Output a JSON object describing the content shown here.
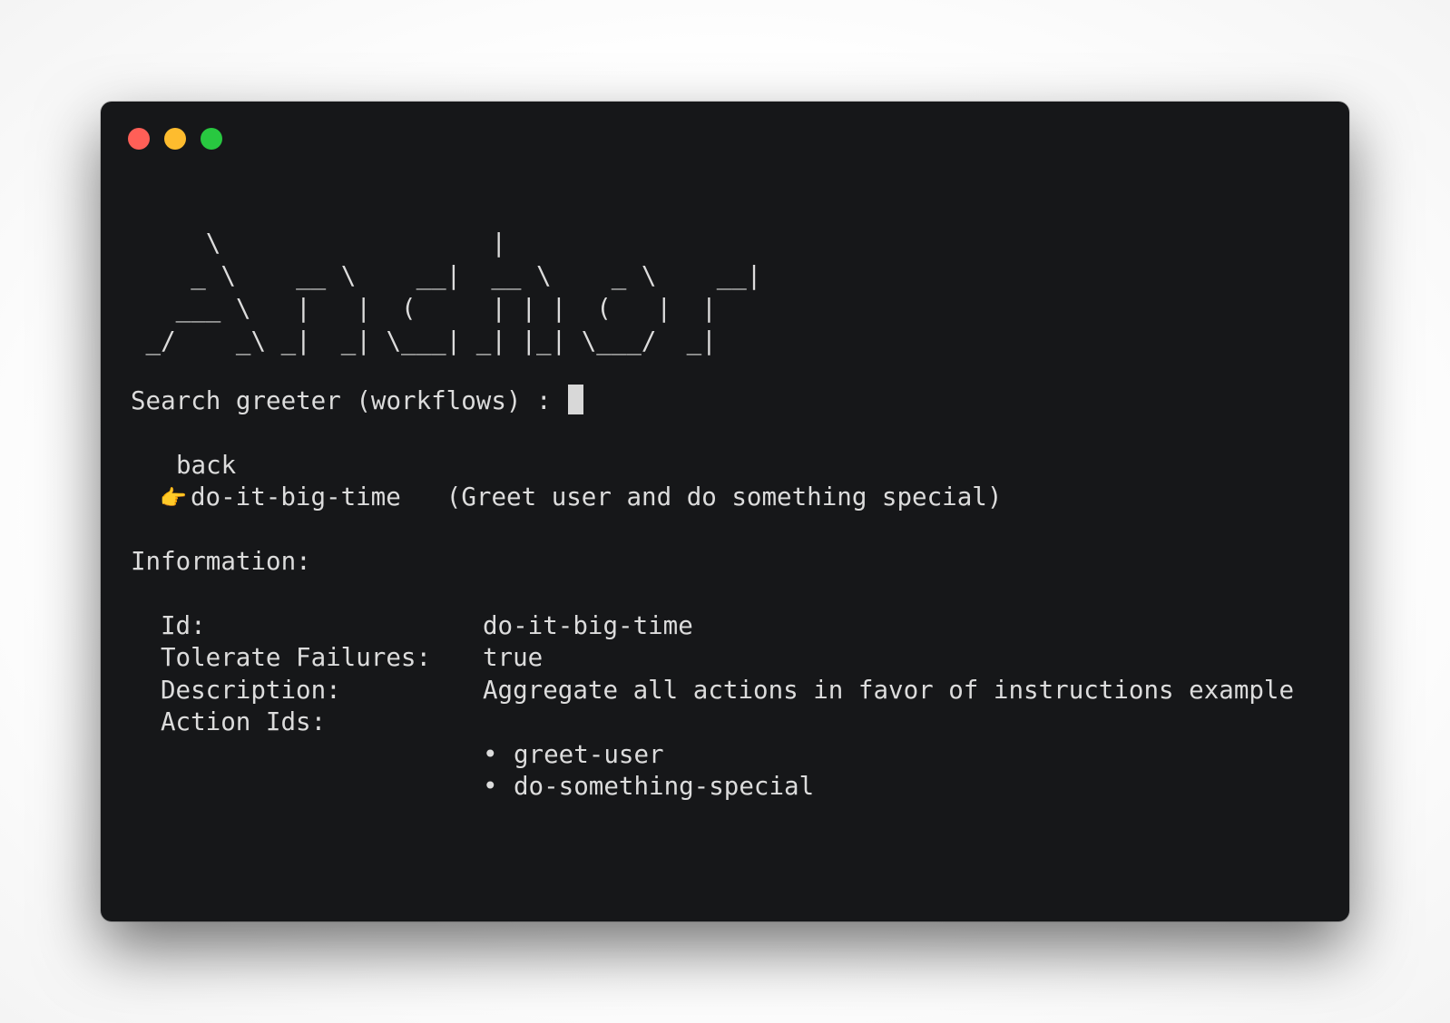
{
  "window": {
    "colors": {
      "background": "#161719",
      "close": "#ff5f57",
      "minimize": "#febc2e",
      "maximize": "#28c840",
      "text": "#dcdcdc"
    }
  },
  "logo_ascii": "     \\                  |\n    _ \\    __ \\    __|  __ \\    _ \\    __|\n   ___ \\   |   |  (     | | |  (   |  |\n _/    _\\ _|  _| \\___| _| |_| \\___/  _|",
  "search": {
    "prompt": "Search greeter (workflows) :",
    "value": ""
  },
  "menu": {
    "items": [
      {
        "label": "back",
        "selected": false
      },
      {
        "label": "do-it-big-time",
        "description": "(Greet user and do something special)",
        "selected": true
      }
    ],
    "pointer_icon": "pointing-hand-icon"
  },
  "information": {
    "heading": "Information:",
    "fields": [
      {
        "label": "Id:",
        "value": "do-it-big-time"
      },
      {
        "label": "Tolerate Failures:",
        "value": "true"
      },
      {
        "label": "Description:",
        "value": "Aggregate all actions in favor of instructions example"
      },
      {
        "label": "Action Ids:",
        "value": ""
      }
    ],
    "action_ids": [
      "greet-user",
      "do-something-special"
    ],
    "bullet": "•"
  }
}
